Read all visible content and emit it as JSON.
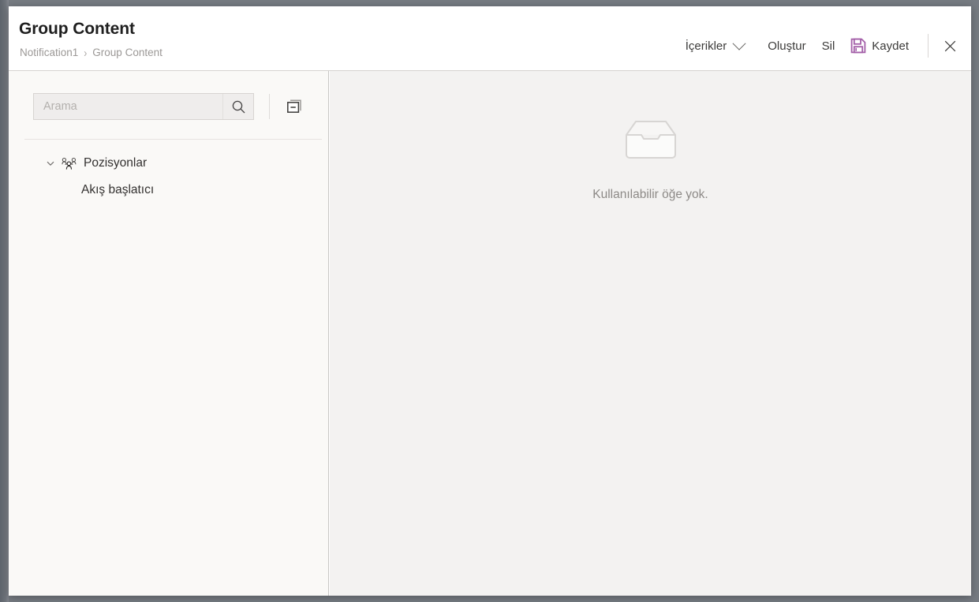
{
  "window": {
    "title": "Group Content",
    "breadcrumb": {
      "parent": "Notification1",
      "separator": "›",
      "current": "Group Content"
    }
  },
  "toolbar": {
    "contents_label": "İçerikler",
    "create_label": "Oluştur",
    "delete_label": "Sil",
    "save_label": "Kaydet",
    "close_label": "×",
    "save_icon": "save-floppy-icon",
    "dropdown_icon": "chevron-down-icon",
    "close_icon": "close-icon"
  },
  "left_panel": {
    "search": {
      "placeholder": "Arama",
      "value": "",
      "search_icon": "search-icon"
    },
    "collapse_all_icon": "collapse-all-icon",
    "tree": {
      "root": {
        "label": "Pozisyonlar",
        "icon": "group-people-icon",
        "expanded": true,
        "expand_icon": "chevron-down-icon"
      },
      "children": [
        {
          "label": "Akış başlatıcı"
        }
      ]
    }
  },
  "right_panel": {
    "empty_state": {
      "icon": "empty-inbox-icon",
      "message": "Kullanılabilir öğe yok."
    }
  },
  "colors": {
    "accent_save": "#a35fa8",
    "title": "#1f1f1f",
    "breadcrumb": "#9b9896",
    "panel_left_bg": "#faf9f7",
    "panel_right_bg": "#f3f2f1",
    "empty_text": "#8d8a87"
  }
}
